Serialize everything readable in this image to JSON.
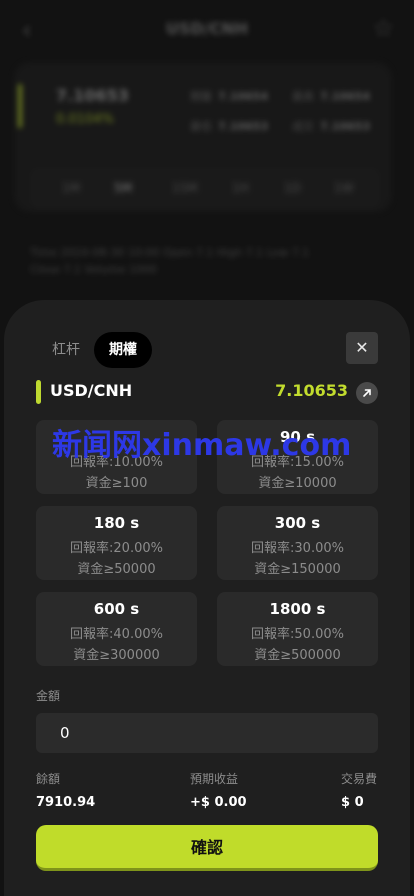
{
  "background": {
    "header_title": "USD/CNH",
    "price": "7.10653",
    "change": "0.0104%",
    "stats": [
      {
        "label": "開盤",
        "value": "7.10654"
      },
      {
        "label": "最高",
        "value": "7.10654"
      },
      {
        "label": "最低",
        "value": "7.10653"
      },
      {
        "label": "成交",
        "value": "7.10653"
      }
    ],
    "tabs": [
      "1M",
      "5M",
      "15M",
      "1H",
      "1D",
      "1W"
    ],
    "ohlc": "Time 2024-08-30 10:00  Open 7.1  High 7.1  Low 7.1  Close 7.1  Volume 1000"
  },
  "sheet": {
    "tabs": [
      {
        "label": "杠杆",
        "active": false
      },
      {
        "label": "期權",
        "active": true
      }
    ],
    "close_label": "✕",
    "pair": "USD/CNH",
    "price": "7.10653",
    "watermark": "新闻网xinmaw.com",
    "durations": [
      {
        "duration": "",
        "rate": "回報率:10.00%",
        "min": "資金≥100"
      },
      {
        "duration": "90 s",
        "rate": "回報率:15.00%",
        "min": "資金≥10000"
      },
      {
        "duration": "180 s",
        "rate": "回報率:20.00%",
        "min": "資金≥50000"
      },
      {
        "duration": "300 s",
        "rate": "回報率:30.00%",
        "min": "資金≥150000"
      },
      {
        "duration": "600 s",
        "rate": "回報率:40.00%",
        "min": "資金≥300000"
      },
      {
        "duration": "1800 s",
        "rate": "回報率:50.00%",
        "min": "資金≥500000"
      }
    ],
    "amount_label": "金額",
    "amount_value": "0",
    "balance_label": "餘額",
    "balance_value": "7910.94",
    "expected_label": "預期收益",
    "expected_value": "+$ 0.00",
    "fee_label": "交易費",
    "fee_value": "$ 0",
    "confirm_label": "確認"
  },
  "colors": {
    "accent": "#c0dc2a",
    "sheet_bg": "#1f1f1f",
    "card_bg": "#2a2a2a"
  }
}
